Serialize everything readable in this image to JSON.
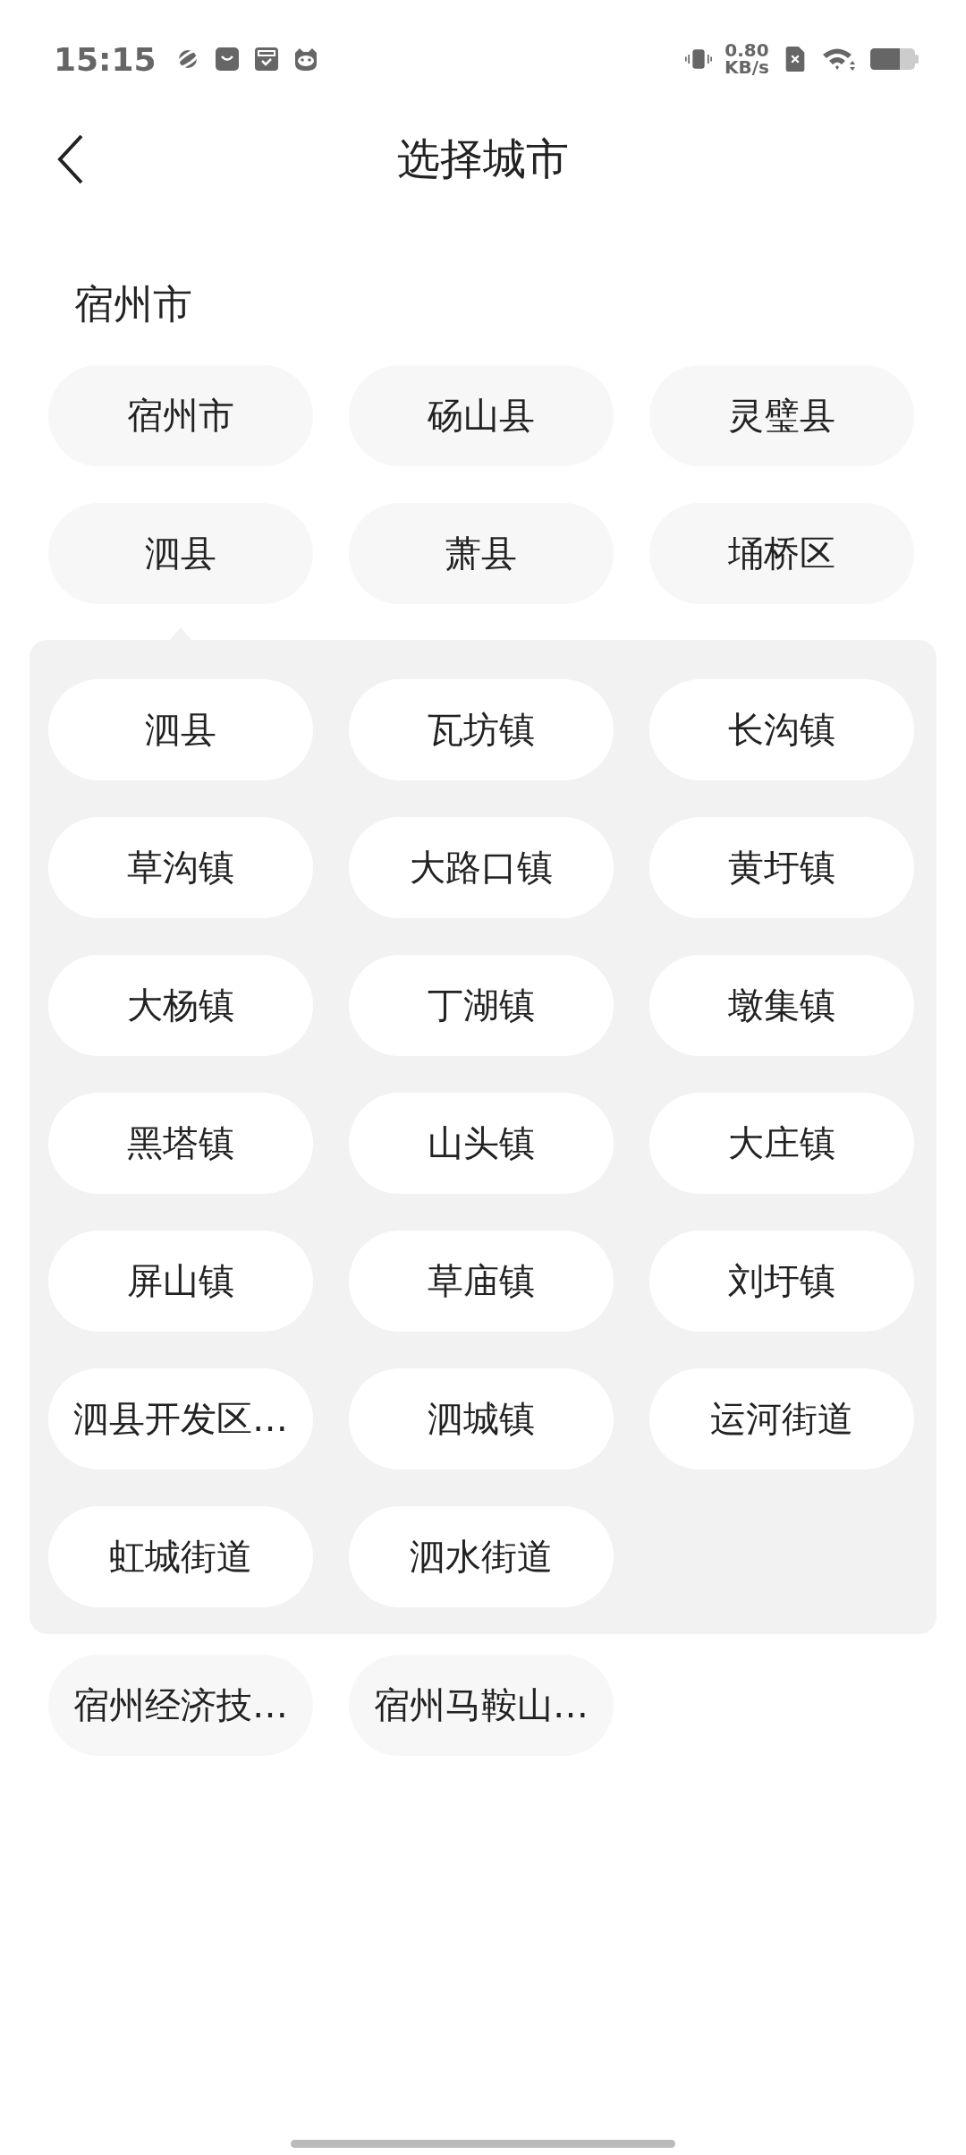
{
  "status_bar": {
    "time": "15:15",
    "net_speed": "0.80",
    "net_unit": "KB/s"
  },
  "header": {
    "title": "选择城市"
  },
  "section": {
    "title": "宿州市"
  },
  "districts": [
    {
      "name": "宿州市",
      "expanded": false
    },
    {
      "name": "砀山县",
      "expanded": false
    },
    {
      "name": "灵璧县",
      "expanded": false
    },
    {
      "name": "泗县",
      "expanded": true,
      "children": [
        {
          "name": "泗县"
        },
        {
          "name": "瓦坊镇"
        },
        {
          "name": "长沟镇"
        },
        {
          "name": "草沟镇"
        },
        {
          "name": "大路口镇"
        },
        {
          "name": "黄圩镇"
        },
        {
          "name": "大杨镇"
        },
        {
          "name": "丁湖镇"
        },
        {
          "name": "墩集镇"
        },
        {
          "name": "黑塔镇"
        },
        {
          "name": "山头镇"
        },
        {
          "name": "大庄镇"
        },
        {
          "name": "屏山镇"
        },
        {
          "name": "草庙镇"
        },
        {
          "name": "刘圩镇"
        },
        {
          "name": "泗县开发区…"
        },
        {
          "name": "泗城镇"
        },
        {
          "name": "运河街道"
        },
        {
          "name": "虹城街道"
        },
        {
          "name": "泗水街道"
        }
      ]
    },
    {
      "name": "萧县",
      "expanded": false
    },
    {
      "name": "埇桥区",
      "expanded": false
    },
    {
      "name": "宿州经济技…",
      "expanded": false
    },
    {
      "name": "宿州马鞍山…",
      "expanded": false
    }
  ]
}
